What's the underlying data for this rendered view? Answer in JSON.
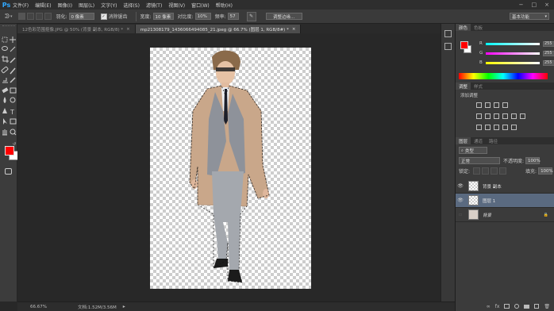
{
  "app": {
    "logo": "Ps"
  },
  "menu": [
    "文件(F)",
    "编辑(E)",
    "图像(I)",
    "图层(L)",
    "文字(Y)",
    "选择(S)",
    "滤镜(T)",
    "视图(V)",
    "窗口(W)",
    "帮助(H)"
  ],
  "window_controls": {
    "minimize": "−",
    "restore": "□",
    "close": "×"
  },
  "options": {
    "feather_label": "羽化:",
    "feather_value": "0 像素",
    "antialias_label": "消除锯齿",
    "antialias_checked": true,
    "width_label": "宽度:",
    "width_value": "10 像素",
    "contrast_label": "对比度:",
    "contrast_value": "10%",
    "frequency_label": "频率:",
    "frequency_value": "57",
    "refine_button": "调整边缘...",
    "workspace": "基本功能"
  },
  "tabs": [
    {
      "label": "12色彩范围抠像.JPG @ 50% (背景 副本, RGB/8) *",
      "close": "×",
      "active": false
    },
    {
      "label": "mp21308179_1436066494085_21.jpeg @ 66.7% (图层 1, RGB/8#) *",
      "close": "×",
      "active": true
    }
  ],
  "tools": [
    "marquee-tool",
    "move-tool",
    "lasso-tool",
    "magic-wand-tool",
    "crop-tool",
    "eyedropper-tool",
    "healing-brush-tool",
    "brush-tool",
    "clone-stamp-tool",
    "history-brush-tool",
    "eraser-tool",
    "gradient-tool",
    "blur-tool",
    "dodge-tool",
    "pen-tool",
    "type-tool",
    "path-selection-tool",
    "shape-tool",
    "hand-tool",
    "zoom-tool"
  ],
  "colors": {
    "foreground": "#ff0000",
    "background": "#ffffff",
    "accent": "#31a8ff"
  },
  "status": {
    "zoom": "66.67%",
    "doc": "文档:1.52M/3.56M"
  },
  "color_panel": {
    "tabs": [
      "颜色",
      "色板"
    ],
    "channels": [
      {
        "label": "R",
        "value": "255"
      },
      {
        "label": "G",
        "value": "255"
      },
      {
        "label": "B",
        "value": "255"
      }
    ]
  },
  "adjust_panel": {
    "tabs": [
      "调整",
      "样式"
    ],
    "title": "添加调整"
  },
  "layers_panel": {
    "tabs": [
      "图层",
      "通道",
      "路径"
    ],
    "filter_label": "类型",
    "blend_mode": "正常",
    "opacity_label": "不透明度:",
    "opacity_value": "100%",
    "lock_label": "锁定:",
    "fill_label": "填充:",
    "fill_value": "100%",
    "layers": [
      {
        "name": "背景 副本",
        "visible": true,
        "selected": false,
        "italic": false
      },
      {
        "name": "图层 1",
        "visible": true,
        "selected": true,
        "italic": false
      },
      {
        "name": "背景",
        "visible": false,
        "selected": false,
        "italic": true
      }
    ]
  }
}
